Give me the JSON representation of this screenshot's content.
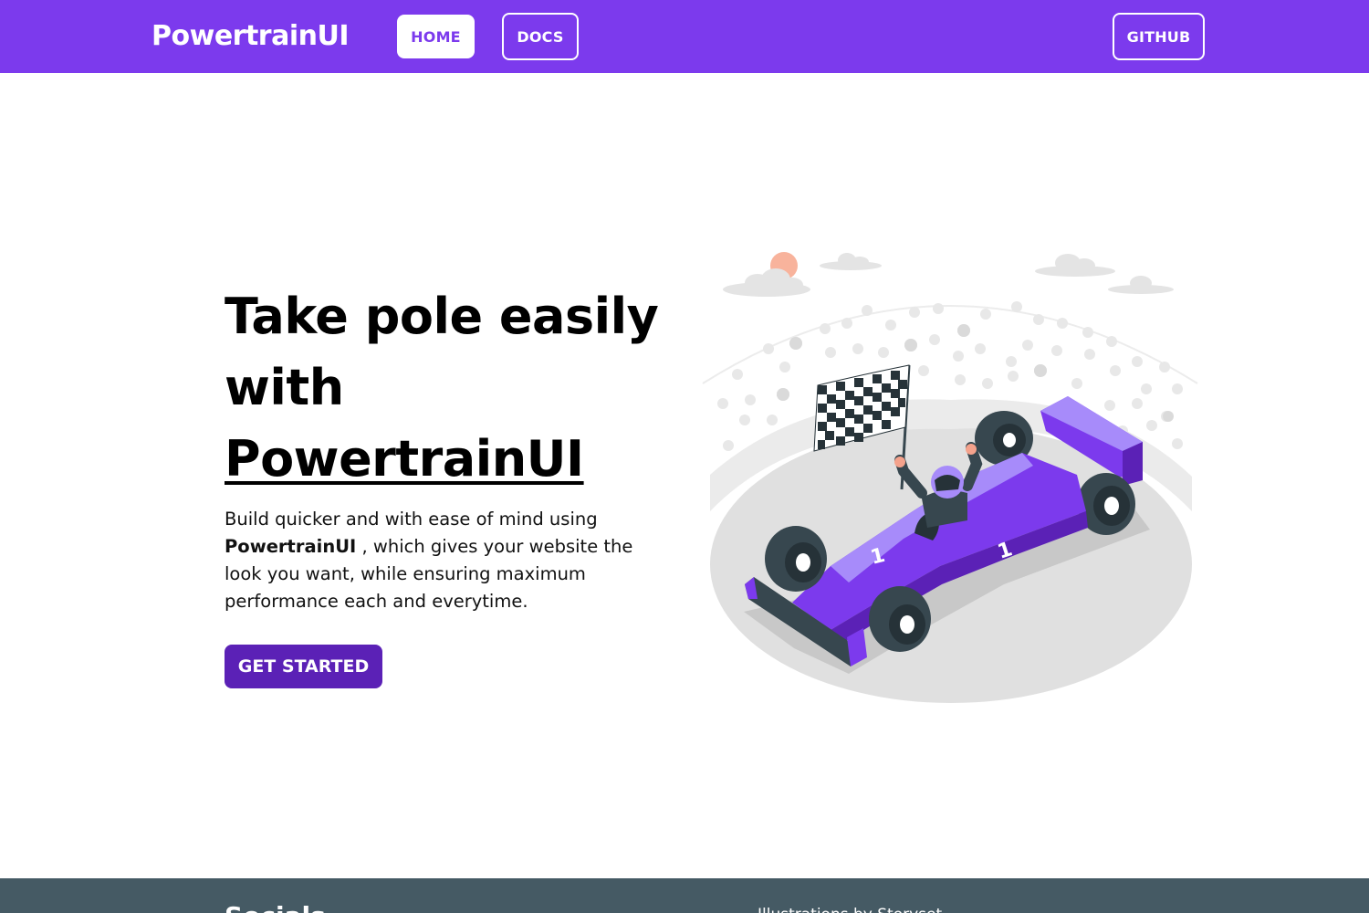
{
  "navbar": {
    "brand": "PowertrainUI",
    "home_label": "HOME",
    "docs_label": "DOCS",
    "github_label": "GITHUB"
  },
  "hero": {
    "title_line1": "Take pole easily",
    "title_line2": "with",
    "title_brand": "PowertrainUI",
    "body_pre": "Build quicker and with ease of mind using",
    "body_brand": "PowertrainUI",
    "body_post": ", which gives your website the look you want, while ensuring maximum performance each and everytime.",
    "cta_label": "GET STARTED",
    "illustration_icon": "race-car-illustration",
    "car_number": "1"
  },
  "footer": {
    "heading": "Socials",
    "credit": "Illustrations by Storyset"
  },
  "colors": {
    "accent": "#7c3aed",
    "cta": "#5b21b6",
    "footer": "#455a64"
  }
}
